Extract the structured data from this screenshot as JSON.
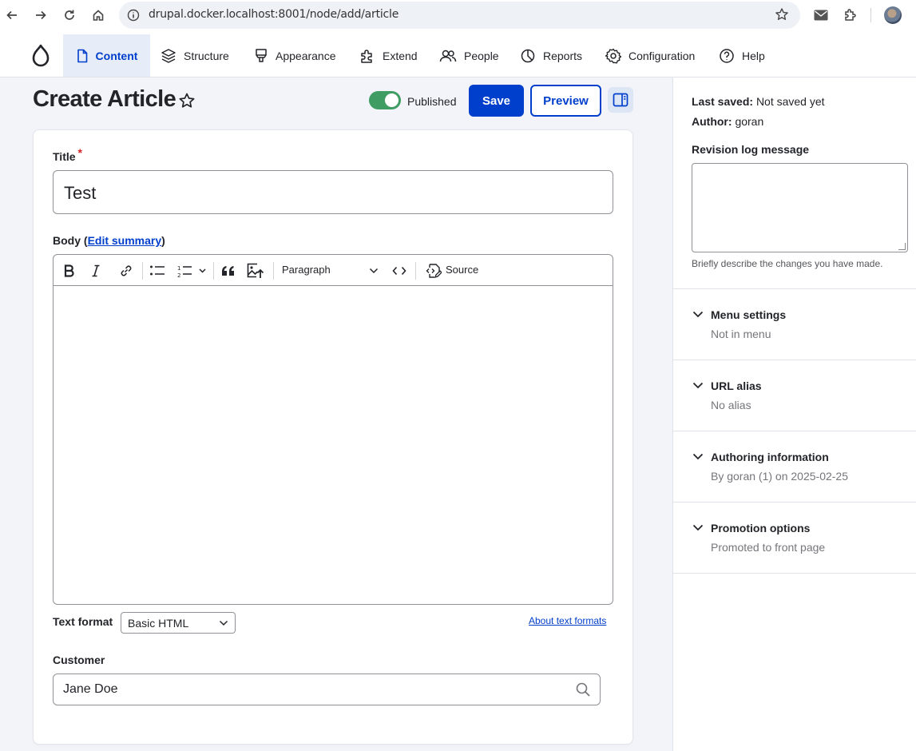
{
  "browser": {
    "url": "drupal.docker.localhost:8001/node/add/article"
  },
  "toolbar": {
    "items": [
      {
        "label": "Content",
        "icon": "document-icon"
      },
      {
        "label": "Structure",
        "icon": "layers-icon"
      },
      {
        "label": "Appearance",
        "icon": "brush-icon"
      },
      {
        "label": "Extend",
        "icon": "puzzle-icon"
      },
      {
        "label": "People",
        "icon": "people-icon"
      },
      {
        "label": "Reports",
        "icon": "pie-chart-icon"
      },
      {
        "label": "Configuration",
        "icon": "gear-icon"
      },
      {
        "label": "Help",
        "icon": "help-icon"
      }
    ],
    "active": "Content"
  },
  "header": {
    "title": "Create Article",
    "published_label": "Published",
    "published": true,
    "save_label": "Save",
    "preview_label": "Preview"
  },
  "form": {
    "title_label": "Title",
    "title_required": "*",
    "title_value": "Test",
    "body_label_prefix": "Body (",
    "body_edit_summary": "Edit summary",
    "body_label_suffix": ")",
    "editor": {
      "paragraph_label": "Paragraph",
      "source_label": "Source"
    },
    "text_format_label": "Text format",
    "text_format_value": "Basic HTML",
    "about_text_formats": "About text formats",
    "customer_label": "Customer",
    "customer_value": "Jane Doe"
  },
  "sidebar": {
    "last_saved_label": "Last saved:",
    "last_saved_value": "Not saved yet",
    "author_label": "Author:",
    "author_value": "goran",
    "revision_label": "Revision log message",
    "revision_value": "",
    "revision_desc": "Briefly describe the changes you have made.",
    "sections": [
      {
        "title": "Menu settings",
        "summary": "Not in menu"
      },
      {
        "title": "URL alias",
        "summary": "No alias"
      },
      {
        "title": "Authoring information",
        "summary": "By goran (1) on 2025-02-25"
      },
      {
        "title": "Promotion options",
        "summary": "Promoted to front page"
      }
    ]
  },
  "colors": {
    "accent": "#003ecc",
    "toggle_on": "#3f9d63",
    "required": "#d72222"
  }
}
